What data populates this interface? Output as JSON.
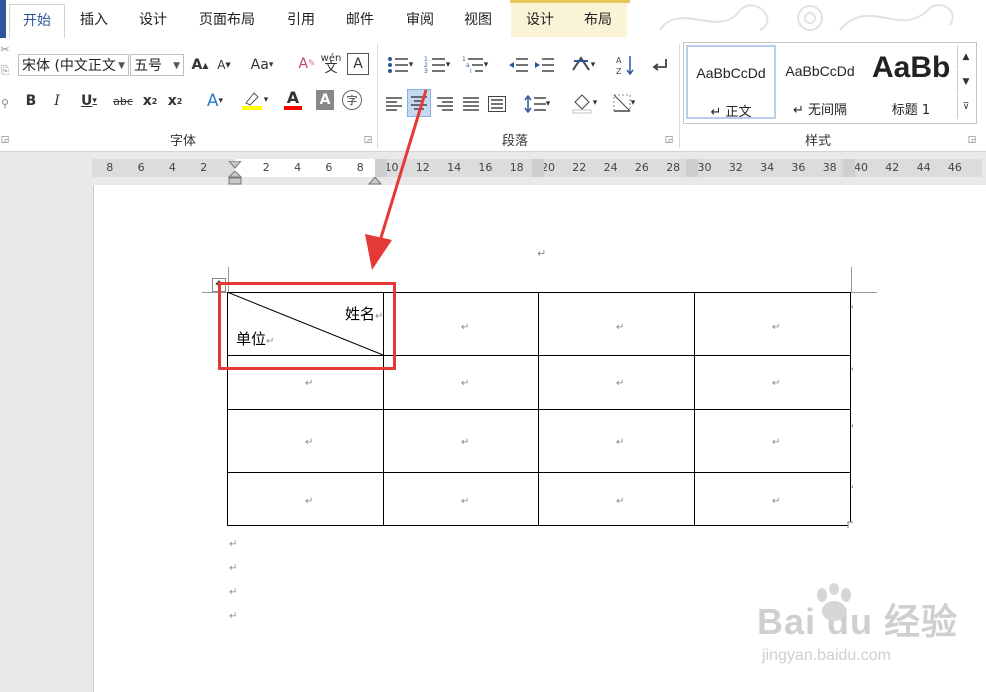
{
  "tabs": [
    "开始",
    "插入",
    "设计",
    "页面布局",
    "引用",
    "邮件",
    "审阅",
    "视图",
    "设计",
    "布局"
  ],
  "font": {
    "name": "宋体 (中文正文",
    "size": "五号",
    "group_label": "字体"
  },
  "paragraph": {
    "group_label": "段落"
  },
  "styles": {
    "group_label": "样式",
    "items": [
      {
        "preview": "AaBbCcDd",
        "name": "正文"
      },
      {
        "preview": "AaBbCcDd",
        "name": "无间隔"
      },
      {
        "preview": "AaBb",
        "name": "标题 1"
      }
    ]
  },
  "ruler": {
    "left_ticks": [
      "8",
      "6",
      "4",
      "2"
    ],
    "right_ticks": [
      "2",
      "4",
      "6",
      "8",
      "10",
      "12",
      "14",
      "16",
      "18",
      "20",
      "22",
      "24",
      "26",
      "28",
      "30",
      "32",
      "34",
      "36",
      "38",
      "40",
      "42",
      "44",
      "46"
    ]
  },
  "table": {
    "header_top_right": "姓名",
    "header_bottom_left": "单位"
  },
  "watermark": {
    "brand": "Bai du 经验",
    "url": "jingyan.baidu.com"
  },
  "colors": {
    "accent": "#2b579a",
    "annotation": "#e53935",
    "highlight_yellow": "#ffff00",
    "font_red": "#ff0000"
  }
}
